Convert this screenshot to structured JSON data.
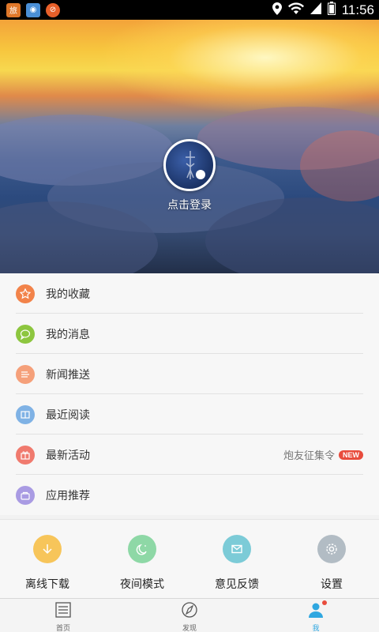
{
  "status_bar": {
    "time": "11:56",
    "notification_apps": [
      "hotel-app-icon",
      "browser-app-icon",
      "ucweb-app-icon"
    ],
    "status_icons": [
      "location-icon",
      "wifi-icon",
      "signal-icon",
      "battery-icon"
    ]
  },
  "hero": {
    "login_label": "点击登录"
  },
  "menu": {
    "items": [
      {
        "label": "我的收藏",
        "icon": "star-icon",
        "color": "#f2834a"
      },
      {
        "label": "我的消息",
        "icon": "message-icon",
        "color": "#8dc63f"
      },
      {
        "label": "新闻推送",
        "icon": "push-icon",
        "color": "#f5a07a"
      },
      {
        "label": "最近阅读",
        "icon": "book-icon",
        "color": "#7fb2e5"
      },
      {
        "label": "最新活动",
        "icon": "gift-icon",
        "color": "#f07a6e",
        "extra_text": "炮友征集令",
        "badge": "NEW"
      },
      {
        "label": "应用推荐",
        "icon": "bag-icon",
        "color": "#a99be3"
      }
    ]
  },
  "quick_actions": [
    {
      "label": "离线下载",
      "icon": "download-icon",
      "color": "#f7c55a"
    },
    {
      "label": "夜间模式",
      "icon": "moon-icon",
      "color": "#8ed8a6"
    },
    {
      "label": "意见反馈",
      "icon": "mail-icon",
      "color": "#7ccbd7"
    },
    {
      "label": "设置",
      "icon": "gear-icon",
      "color": "#b2bcc4"
    }
  ],
  "tabbar": {
    "tabs": [
      {
        "label": "首页",
        "icon": "home-news-icon"
      },
      {
        "label": "发现",
        "icon": "compass-icon"
      },
      {
        "label": "我",
        "icon": "person-icon",
        "active": true
      }
    ],
    "accent": "#2fa7e0"
  }
}
